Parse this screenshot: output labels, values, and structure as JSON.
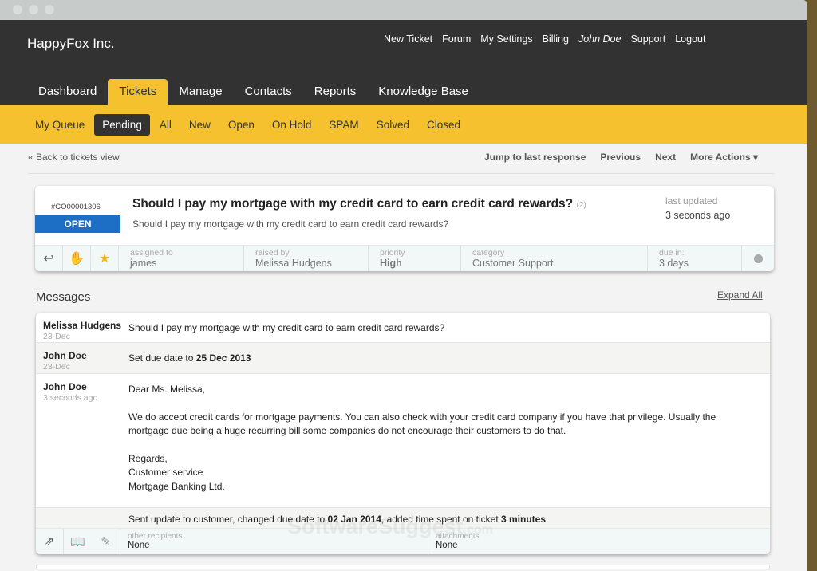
{
  "header": {
    "logo": "HappyFox Inc.",
    "links": [
      "New Ticket",
      "Forum",
      "My Settings",
      "Billing",
      "John Doe",
      "Support",
      "Logout"
    ]
  },
  "tabs": [
    "Dashboard",
    "Tickets",
    "Manage",
    "Contacts",
    "Reports",
    "Knowledge Base"
  ],
  "subtabs": [
    "My Queue",
    "Pending",
    "All",
    "New",
    "Open",
    "On Hold",
    "SPAM",
    "Solved",
    "Closed"
  ],
  "actions": {
    "back": "« Back to tickets view",
    "jump": "Jump to last response",
    "previous": "Previous",
    "next": "Next",
    "more": "More Actions ▾"
  },
  "ticket": {
    "id": "#CO00001306",
    "status": "OPEN",
    "title": "Should I pay my mortgage with my credit card to earn credit card rewards?",
    "count": "(2)",
    "subtitle": "Should I pay my mortgage with my credit card to earn credit card rewards?",
    "last_updated_label": "last updated",
    "last_updated": "3 seconds ago",
    "fields": [
      {
        "label": "assigned to",
        "value": "james"
      },
      {
        "label": "raised by",
        "value": "Melissa Hudgens"
      },
      {
        "label": "priority",
        "value": "High"
      },
      {
        "label": "category",
        "value": "Customer Support"
      },
      {
        "label": "due in:",
        "value": "3 days"
      }
    ],
    "icons": [
      "reply-icon",
      "hand-icon",
      "star-icon"
    ]
  },
  "messages": {
    "title": "Messages",
    "expand": "Expand All",
    "items": [
      {
        "author": "Melissa Hudgens",
        "time": "23-Dec",
        "text": "Should I pay my mortgage with my credit card to earn credit card rewards?"
      },
      {
        "author": "John Doe",
        "time": "23-Dec",
        "text": "Set due date to ",
        "bold": "25 Dec 2013"
      },
      {
        "author": "John Doe",
        "time": "3 seconds ago",
        "greeting": "Dear Ms. Melissa,",
        "para": "We do accept credit cards for mortgage payments. You can also check with your credit card company if you have that privilege. Usually the mortgage due being a huge recurring bill some companies do not encourage their customers to do that.",
        "sign1": "Regards,",
        "sign2": "Customer service",
        "sign3": "Mortgage Banking Ltd."
      }
    ],
    "sent": {
      "t1": "Sent update to customer, changed due date to ",
      "b1": "02 Jan 2014",
      "t2": ", added time spent on ticket ",
      "b2": "3 minutes"
    },
    "recipients_label": "other recipients",
    "recipients": "None",
    "attachments_label": "attachments",
    "attachments": "None"
  },
  "watermark": {
    "main": "SoftwareSuggest",
    "suffix": ".com"
  }
}
